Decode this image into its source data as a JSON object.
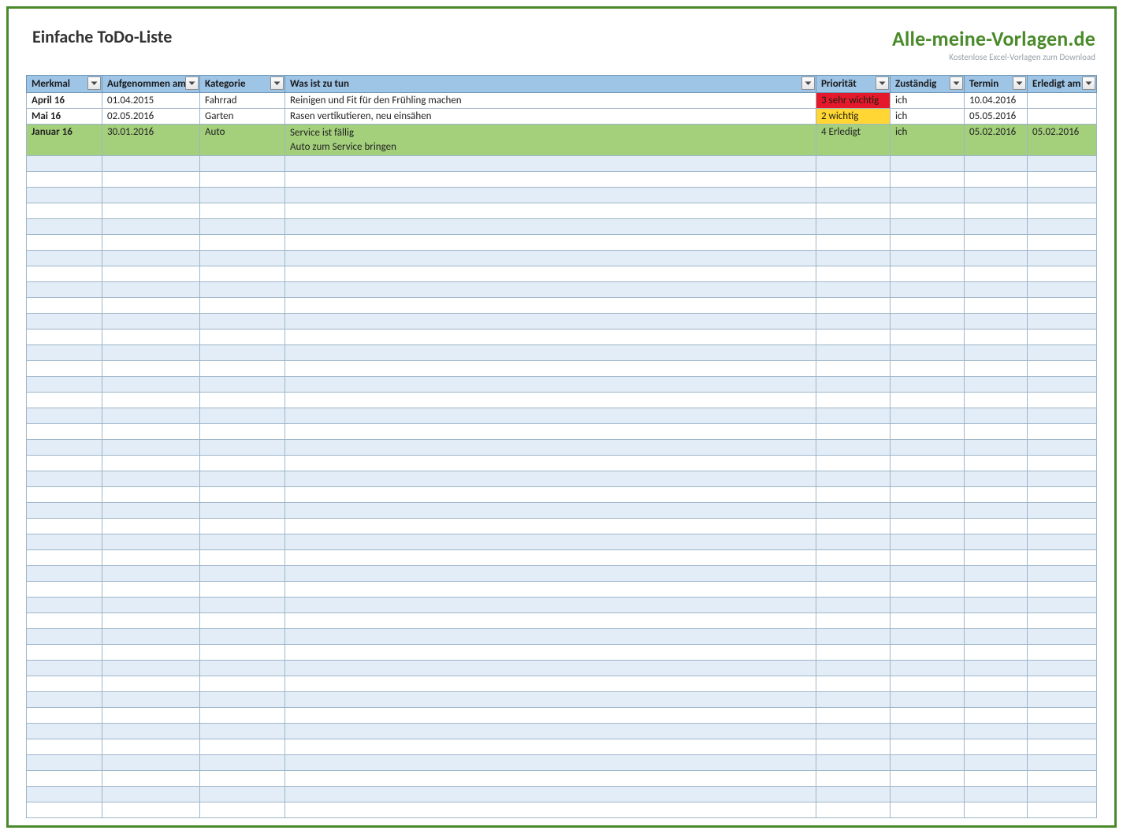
{
  "header": {
    "title": "Einfache ToDo-Liste",
    "brand_name": "Alle-meine-Vorlagen.de",
    "brand_sub": "Kostenlose Excel-Vorlagen zum Download"
  },
  "columns": [
    {
      "key": "merkmal",
      "label": "Merkmal"
    },
    {
      "key": "aufg",
      "label": "Aufgenommen am"
    },
    {
      "key": "kat",
      "label": "Kategorie"
    },
    {
      "key": "was",
      "label": "Was ist zu tun"
    },
    {
      "key": "prio",
      "label": "Priorität"
    },
    {
      "key": "zust",
      "label": "Zuständig"
    },
    {
      "key": "termin",
      "label": "Termin"
    },
    {
      "key": "erledigt",
      "label": "Erledigt am"
    }
  ],
  "rows": [
    {
      "merkmal": "April 16",
      "aufg": "01.04.2015",
      "kat": "Fahrrad",
      "was": "Reinigen und Fit für den Frühling machen",
      "prio": "3 sehr wichtig",
      "prio_style": "red",
      "zust": "ich",
      "termin": "10.04.2016",
      "erledigt": "",
      "row_style": "plain"
    },
    {
      "merkmal": "Mai 16",
      "aufg": "02.05.2016",
      "kat": "Garten",
      "was": "Rasen vertikutieren, neu einsähen",
      "prio": "2 wichtig",
      "prio_style": "yellow",
      "zust": "ich",
      "termin": "05.05.2016",
      "erledigt": "",
      "row_style": "plain"
    },
    {
      "merkmal": "Januar 16",
      "aufg": "30.01.2016",
      "kat": "Auto",
      "was": "Service ist fällig\nAuto zum Service bringen",
      "prio": "4 Erledigt",
      "prio_style": "",
      "zust": "ich",
      "termin": "05.02.2016",
      "erledigt": "05.02.2016",
      "row_style": "done"
    }
  ],
  "empty_row_count": 42
}
